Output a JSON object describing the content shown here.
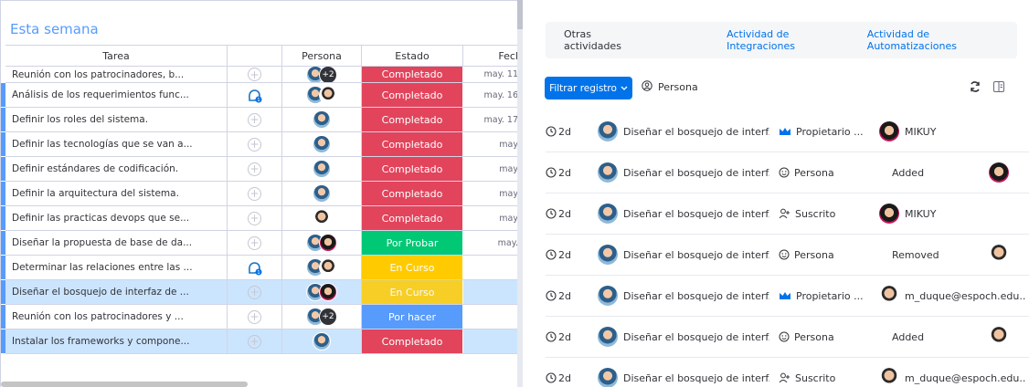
{
  "board": {
    "group_title": "Esta semana",
    "columns": {
      "task": "Tarea",
      "person": "Persona",
      "state": "Estado",
      "date": "Fecl"
    },
    "rows": [
      {
        "task": "Reunión con los patrocinadores, b...",
        "update": "plus",
        "persons": [
          "a",
          "+2"
        ],
        "state": "Completado",
        "state_class": "done",
        "date": "may. 11",
        "first": true
      },
      {
        "task": "Análisis de los requerimientos func...",
        "update": "bubble",
        "persons": [
          "a",
          "b"
        ],
        "state": "Completado",
        "state_class": "done",
        "date": "may. 16"
      },
      {
        "task": "Definir los roles del sistema.",
        "update": "plus",
        "persons": [
          "a"
        ],
        "state": "Completado",
        "state_class": "done",
        "date": "may. 17"
      },
      {
        "task": "Definir las tecnologías que se van a...",
        "update": "plus",
        "persons": [
          "a"
        ],
        "state": "Completado",
        "state_class": "done",
        "date": "may"
      },
      {
        "task": "Definir estándares de codificación.",
        "update": "plus",
        "persons": [
          "a"
        ],
        "state": "Completado",
        "state_class": "done",
        "date": "may"
      },
      {
        "task": "Definir la arquitectura del sistema.",
        "update": "plus",
        "persons": [
          "a"
        ],
        "state": "Completado",
        "state_class": "done",
        "date": "may"
      },
      {
        "task": "Definir las practicas devops que se...",
        "update": "plus",
        "persons": [
          "b"
        ],
        "state": "Completado",
        "state_class": "done",
        "date": "may"
      },
      {
        "task": "Diseñar la propuesta de base de da...",
        "update": "plus",
        "persons": [
          "a",
          "r"
        ],
        "state": "Por Probar",
        "state_class": "test",
        "date": "may."
      },
      {
        "task": "Determinar las relaciones entre las ...",
        "update": "bubble",
        "persons": [
          "a",
          "b"
        ],
        "state": "En Curso",
        "state_class": "prog",
        "date": ""
      },
      {
        "task": "Diseñar el bosquejo de interfaz de ...",
        "update": "plus",
        "persons": [
          "a",
          "r"
        ],
        "state": "En Curso",
        "state_class": "prog2",
        "date": "",
        "selected": true
      },
      {
        "task": "Reunión con los patrocinadores y ...",
        "update": "plus",
        "persons": [
          "a",
          "+2"
        ],
        "state": "Por hacer",
        "state_class": "todo",
        "date": ""
      },
      {
        "task": "Instalar los frameworks y compone...",
        "update": "plus",
        "persons": [
          "a"
        ],
        "state": "Completado",
        "state_class": "done",
        "date": "",
        "selected": true
      }
    ]
  },
  "panel": {
    "tabs": {
      "other": "Otras actividades",
      "integrations": "Actividad de Integraciones",
      "automations": "Actividad de Automatizaciones"
    },
    "filter_button": "Filtrar registro",
    "person_filter": "Persona",
    "activities": [
      {
        "time": "2d",
        "item": "Diseñar el bosquejo de interf...",
        "column": "Propietario ...",
        "column_icon": "crown-icon",
        "value": "MIKUY",
        "value_avatar": "red",
        "trail": ""
      },
      {
        "time": "2d",
        "item": "Diseñar el bosquejo de interf...",
        "column": "Persona",
        "column_icon": "face-icon",
        "value": "Added",
        "value_avatar": "",
        "trail": "red"
      },
      {
        "time": "2d",
        "item": "Diseñar el bosquejo de interf...",
        "column": "Suscrito",
        "column_icon": "sub-icon",
        "value": "MIKUY",
        "value_avatar": "red",
        "trail": ""
      },
      {
        "time": "2d",
        "item": "Diseñar el bosquejo de interf...",
        "column": "Persona",
        "column_icon": "face-icon",
        "value": "Removed",
        "value_avatar": "",
        "trail": "boy"
      },
      {
        "time": "2d",
        "item": "Diseñar el bosquejo de interf...",
        "column": "Propietario ...",
        "column_icon": "crown-icon",
        "value": "m_duque@espoch.edu...",
        "value_avatar": "boy",
        "trail": ""
      },
      {
        "time": "2d",
        "item": "Diseñar el bosquejo de interf...",
        "column": "Persona",
        "column_icon": "face-icon",
        "value": "Added",
        "value_avatar": "",
        "trail": "boy"
      },
      {
        "time": "2d",
        "item": "Diseñar el bosquejo de interf...",
        "column": "Suscrito",
        "column_icon": "sub-icon",
        "value": "m_duque@espoch.edu...",
        "value_avatar": "boy",
        "trail": ""
      }
    ]
  },
  "colors": {
    "done": "#e2445c",
    "test": "#00c875",
    "prog": "#ffcb00",
    "todo": "#579bfc",
    "accent": "#0073ea",
    "group": "#579bfc"
  }
}
